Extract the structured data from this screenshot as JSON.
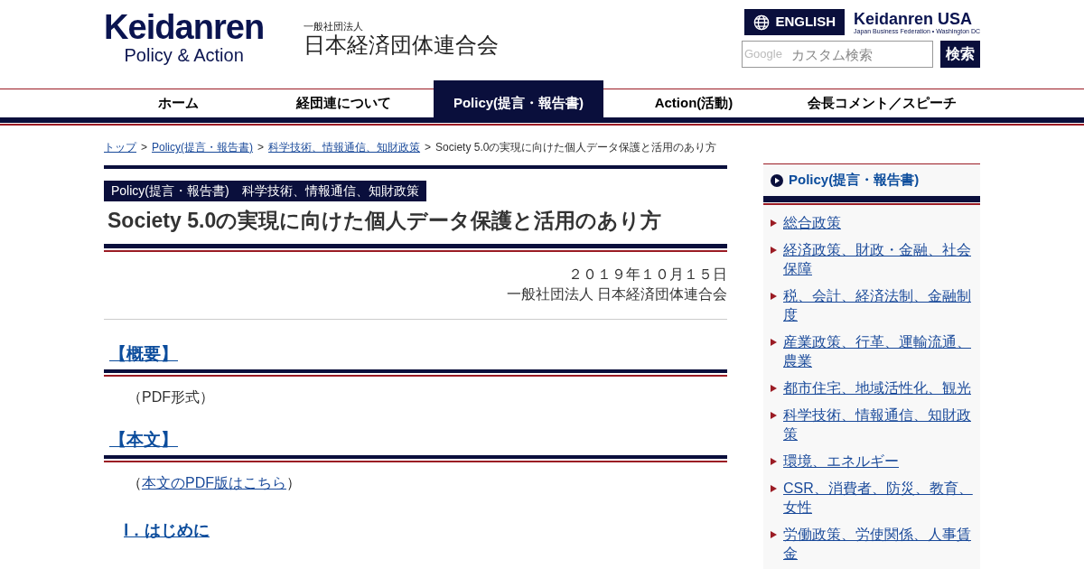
{
  "header": {
    "logo_title": "Keidanren",
    "logo_subtitle": "Policy & Action",
    "org_label": "一般社団法人",
    "org_name": "日本経済団体連合会",
    "english_button": "ENGLISH",
    "usa_logo_title": "Keidanren USA",
    "usa_logo_subtitle": "Japan Business Federation • Washington DC",
    "search": {
      "brand": "Google",
      "placeholder": "カスタム検索",
      "button": "検索"
    }
  },
  "nav": [
    {
      "label": "ホーム",
      "selected": false
    },
    {
      "label": "経団連について",
      "selected": false
    },
    {
      "label": "Policy(提言・報告書)",
      "selected": true
    },
    {
      "label": "Action(活動)",
      "selected": false
    },
    {
      "label": "会長コメント／スピーチ",
      "selected": false
    }
  ],
  "breadcrumb": {
    "separator": ">",
    "items": [
      {
        "label": "トップ",
        "link": true
      },
      {
        "label": "Policy(提言・報告書)",
        "link": true
      },
      {
        "label": "科学技術、情報通信、知財政策",
        "link": true
      },
      {
        "label": "Society 5.0の実現に向けた個人データ保護と活用のあり方",
        "link": false
      }
    ]
  },
  "article": {
    "category_labels": [
      "Policy(提言・報告書)",
      "科学技術、情報通信、知財政策"
    ],
    "title": "Society 5.0の実現に向けた個人データ保護と活用のあり方",
    "date": "２０１９年１０月１５日",
    "author": "一般社団法人 日本経済団体連合会",
    "sections": [
      {
        "heading": "【概要】",
        "note": [
          {
            "kind": "text",
            "text": "（PDF形式）"
          }
        ]
      },
      {
        "heading": "【本文】",
        "note": [
          {
            "kind": "text",
            "text": "（"
          },
          {
            "kind": "link",
            "text": "本文のPDF版はこちら"
          },
          {
            "kind": "text",
            "text": "）"
          }
        ]
      }
    ],
    "toc": [
      "Ⅰ．はじめに"
    ]
  },
  "sidebar": {
    "heading": "Policy(提言・報告書)",
    "items": [
      "総合政策",
      "経済政策、財政・金融、社会保障",
      "税、会計、経済法制、金融制度",
      "産業政策、行革、運輸流通、農業",
      "都市住宅、地域活性化、観光",
      "科学技術、情報通信、知財政策",
      "環境、エネルギー",
      "CSR、消費者、防災、教育、女性",
      "労働政策、労使関係、人事賃金"
    ]
  }
}
